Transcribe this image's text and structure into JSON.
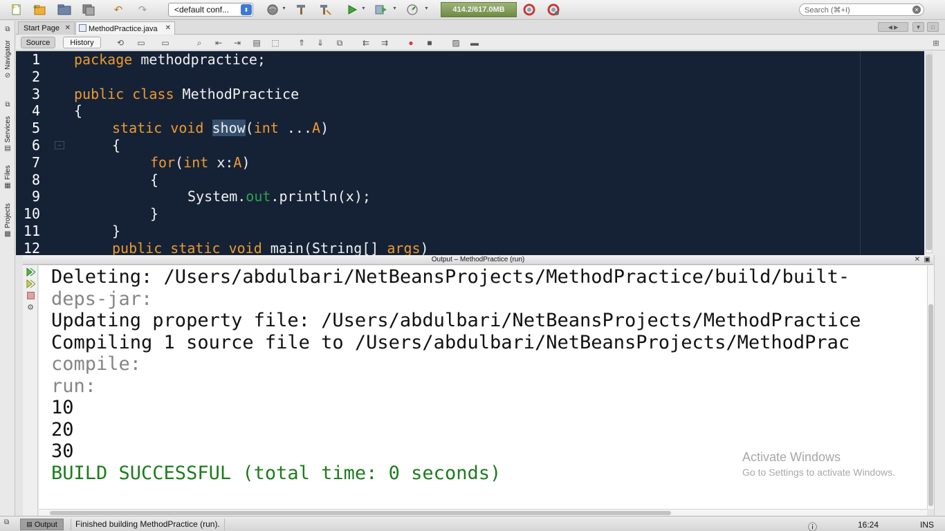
{
  "toolbar": {
    "icons": [
      "new-file-icon",
      "new-project-icon",
      "open-project-icon",
      "save-all-icon",
      "undo-icon",
      "redo-icon",
      "globe-icon",
      "hammer-icon",
      "clean-build-icon",
      "run-icon",
      "debug-icon",
      "profile-icon",
      "gc-icon-1",
      "gc-icon-2"
    ],
    "config": "<default conf...",
    "memory": "414.2/617.0MB",
    "search_placeholder": "Search (⌘+I)"
  },
  "left_dock": [
    "Navigator",
    "Services",
    "Files",
    "Projects"
  ],
  "tabs": [
    {
      "label": "Start Page",
      "active": false
    },
    {
      "label": "MethodPractice.java",
      "active": true
    }
  ],
  "editor_toolbar": {
    "source": "Source",
    "history": "History"
  },
  "editor": {
    "lines": [
      {
        "n": "1"
      },
      {
        "n": "2"
      },
      {
        "n": "3"
      },
      {
        "n": "4"
      },
      {
        "n": "5"
      },
      {
        "n": "6"
      },
      {
        "n": "7"
      },
      {
        "n": "8"
      },
      {
        "n": "9"
      },
      {
        "n": "10"
      },
      {
        "n": "11"
      },
      {
        "n": "12"
      }
    ],
    "code": {
      "l1_kw": "package",
      "l1_rest": " methodpractice;",
      "l3_kw": "public class",
      "l3_rest": " MethodPractice",
      "l4": "{",
      "l5_kw": "static void",
      "l5_sp": " ",
      "l5_sel": "show",
      "l5_p": "(",
      "l5_kw2": "int",
      "l5_dots": " ...",
      "l5_param": "A",
      "l5_end": ")",
      "l6": "{",
      "l7_kw": "for",
      "l7_p": "(",
      "l7_kw2": "int",
      "l7_mid": " x:",
      "l7_param": "A",
      "l7_end": ")",
      "l8": "{",
      "l9_a": "System.",
      "l9_fld": "out",
      "l9_b": ".println(x);",
      "l10": "}",
      "l11": "}",
      "l12_kw": "public static void",
      "l12_rest": " main(String[] ",
      "l12_param": "args",
      "l12_end": ")"
    }
  },
  "output": {
    "title": "Output – MethodPractice (run)",
    "lines": [
      {
        "text": "Deleting: /Users/abdulbari/NetBeansProjects/MethodPractice/build/built-",
        "style": "normal"
      },
      {
        "text": "deps-jar:",
        "style": "grey"
      },
      {
        "text": "Updating property file: /Users/abdulbari/NetBeansProjects/MethodPractice",
        "style": "normal"
      },
      {
        "text": "Compiling 1 source file to /Users/abdulbari/NetBeansProjects/MethodPrac",
        "style": "normal"
      },
      {
        "text": "compile:",
        "style": "grey"
      },
      {
        "text": "run:",
        "style": "grey"
      },
      {
        "text": "10",
        "style": "normal"
      },
      {
        "text": "20",
        "style": "normal"
      },
      {
        "text": "30",
        "style": "normal"
      },
      {
        "text": "BUILD SUCCESSFUL (total time: 0 seconds)",
        "style": "green"
      }
    ]
  },
  "watermark": {
    "line1": "Activate Windows",
    "line2": "Go to Settings to activate Windows."
  },
  "status": {
    "output_tab": "Output",
    "message": "Finished building MethodPractice (run).",
    "position": "16:24",
    "mode": "INS"
  }
}
